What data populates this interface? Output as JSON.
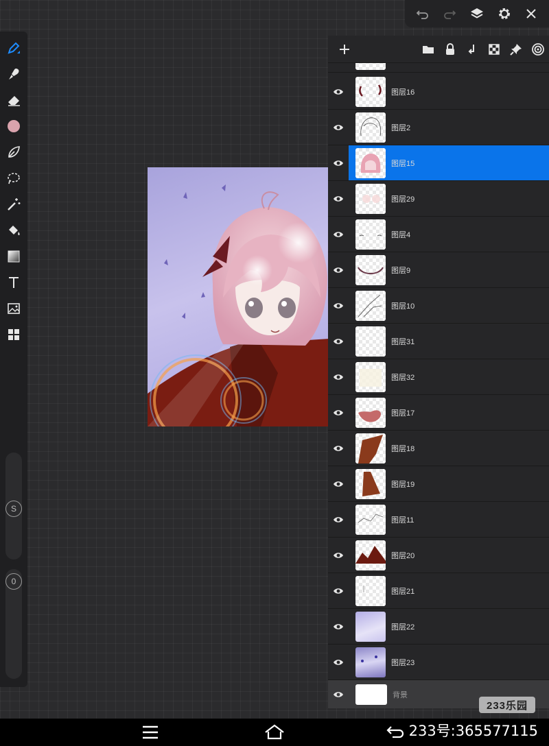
{
  "toolbar": {
    "icons": [
      "undo-icon",
      "redo-icon",
      "layers-icon",
      "settings-icon",
      "close-icon"
    ]
  },
  "tools": [
    "pen",
    "brush",
    "eraser",
    "color",
    "smudge",
    "lasso",
    "magic-wand",
    "fill",
    "gradient",
    "text",
    "image",
    "grid"
  ],
  "sliders": {
    "size_label": "S",
    "opacity_label": "0"
  },
  "layers_panel": {
    "header_icons": [
      "add-icon",
      "folder-icon",
      "lock-icon",
      "merge-down-icon",
      "transparency-icon",
      "pin-icon",
      "target-icon"
    ],
    "layers": [
      {
        "name": "图层16",
        "selected": false
      },
      {
        "name": "图层2",
        "selected": false
      },
      {
        "name": "图层15",
        "selected": true
      },
      {
        "name": "图层29",
        "selected": false
      },
      {
        "name": "图层4",
        "selected": false
      },
      {
        "name": "图层9",
        "selected": false
      },
      {
        "name": "图层10",
        "selected": false
      },
      {
        "name": "图层31",
        "selected": false
      },
      {
        "name": "图层32",
        "selected": false
      },
      {
        "name": "图层17",
        "selected": false
      },
      {
        "name": "图层18",
        "selected": false
      },
      {
        "name": "图层19",
        "selected": false
      },
      {
        "name": "图层11",
        "selected": false
      },
      {
        "name": "图层20",
        "selected": false
      },
      {
        "name": "图层21",
        "selected": false
      },
      {
        "name": "图层22",
        "selected": false
      },
      {
        "name": "图层23",
        "selected": false
      }
    ],
    "background_layer": "背景"
  },
  "watermark": "233乐园",
  "nav": {
    "id_text": "233号:365577115"
  },
  "colors": {
    "selected_layer": "#0a74ea",
    "current_color": "#d9a3ad"
  }
}
